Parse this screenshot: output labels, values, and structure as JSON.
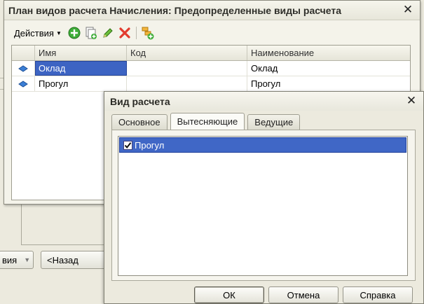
{
  "parent_window": {
    "title": "План видов расчета Начисления: Предопределенные виды расчета",
    "toolbar": {
      "actions_label": "Действия"
    },
    "grid": {
      "columns": [
        "Имя",
        "Код",
        "Наименование"
      ],
      "rows": [
        {
          "name": "Оклад",
          "code": "",
          "description": "Оклад"
        },
        {
          "name": "Прогул",
          "code": "",
          "description": "Прогул"
        }
      ]
    }
  },
  "background_wizard": {
    "left_button_label": "вия",
    "back_button_label": "<Назад"
  },
  "dialog": {
    "title": "Вид расчета",
    "tabs": [
      {
        "label": "Основное",
        "active": false
      },
      {
        "label": "Вытесняющие",
        "active": true
      },
      {
        "label": "Ведущие",
        "active": false
      }
    ],
    "list_items": [
      {
        "label": "Прогул",
        "checked": true
      }
    ],
    "buttons": {
      "ok": "ОК",
      "cancel": "Отмена",
      "help": "Справка"
    }
  },
  "colors": {
    "selection": "#3d64c3",
    "window_bg": "#eceade"
  }
}
